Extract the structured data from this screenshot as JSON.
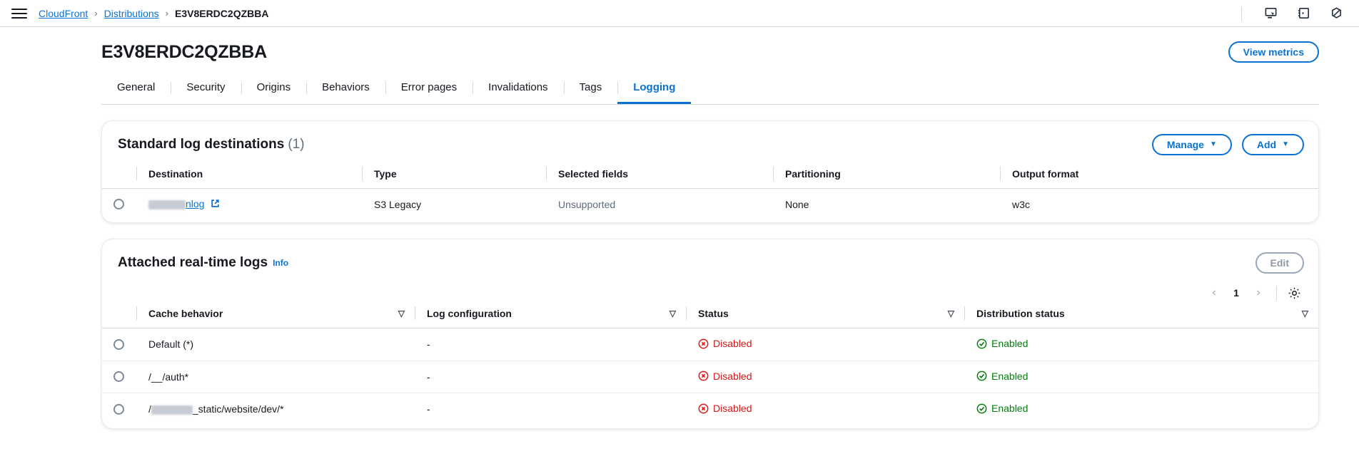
{
  "topbar": {
    "menu_icon": "hamburger-icon",
    "breadcrumb": {
      "root": "CloudFront",
      "parent": "Distributions",
      "current": "E3V8ERDC2QZBBA",
      "separator": "›"
    },
    "icons": [
      {
        "name": "screen-cursor-icon",
        "label": "Monitoring"
      },
      {
        "name": "cloudshell-icon",
        "label": "CloudShell"
      },
      {
        "name": "settings-nut-icon",
        "label": "Settings"
      }
    ]
  },
  "page": {
    "title": "E3V8ERDC2QZBBA",
    "view_metrics_label": "View metrics"
  },
  "tabs": [
    {
      "label": "General",
      "active": false
    },
    {
      "label": "Security",
      "active": false
    },
    {
      "label": "Origins",
      "active": false
    },
    {
      "label": "Behaviors",
      "active": false
    },
    {
      "label": "Error pages",
      "active": false
    },
    {
      "label": "Invalidations",
      "active": false
    },
    {
      "label": "Tags",
      "active": false
    },
    {
      "label": "Logging",
      "active": true
    }
  ],
  "standard_logs": {
    "title": "Standard log destinations",
    "count": "(1)",
    "manage_label": "Manage",
    "add_label": "Add",
    "caret": "▼",
    "columns": [
      "Destination",
      "Type",
      "Selected fields",
      "Partitioning",
      "Output format"
    ],
    "rows": [
      {
        "destination_redacted": true,
        "destination_suffix": "nlog",
        "destination_external_link": true,
        "type": "S3 Legacy",
        "selected_fields": "Unsupported",
        "partitioning": "None",
        "output_format": "w3c"
      }
    ]
  },
  "realtime_logs": {
    "title": "Attached real-time logs",
    "info_label": "Info",
    "edit_label": "Edit",
    "edit_disabled": true,
    "pagination": {
      "prev": "‹",
      "page": "1",
      "next": "›",
      "settings_icon": "gear-icon"
    },
    "columns": [
      "Cache behavior",
      "Log configuration",
      "Status",
      "Distribution status"
    ],
    "sort_glyph": "▽",
    "rows": [
      {
        "cache_behavior": "Default (*)",
        "cache_behavior_redacted": false,
        "log_configuration": "-",
        "status": "Disabled",
        "status_state": "disabled",
        "distribution_status": "Enabled",
        "distribution_state": "enabled"
      },
      {
        "cache_behavior": "/__/auth*",
        "cache_behavior_redacted": false,
        "log_configuration": "-",
        "status": "Disabled",
        "status_state": "disabled",
        "distribution_status": "Enabled",
        "distribution_state": "enabled"
      },
      {
        "cache_behavior_prefix": "/",
        "cache_behavior_suffix": "_static/website/dev/*",
        "cache_behavior_redacted": true,
        "log_configuration": "-",
        "status": "Disabled",
        "status_state": "disabled",
        "distribution_status": "Enabled",
        "distribution_state": "enabled"
      }
    ]
  },
  "colors": {
    "link_blue": "#0972d3",
    "error_red": "#d91515",
    "success_green": "#037f0c",
    "text": "#16191f",
    "muted": "#5f6b7a",
    "border": "#d5dbdb"
  }
}
